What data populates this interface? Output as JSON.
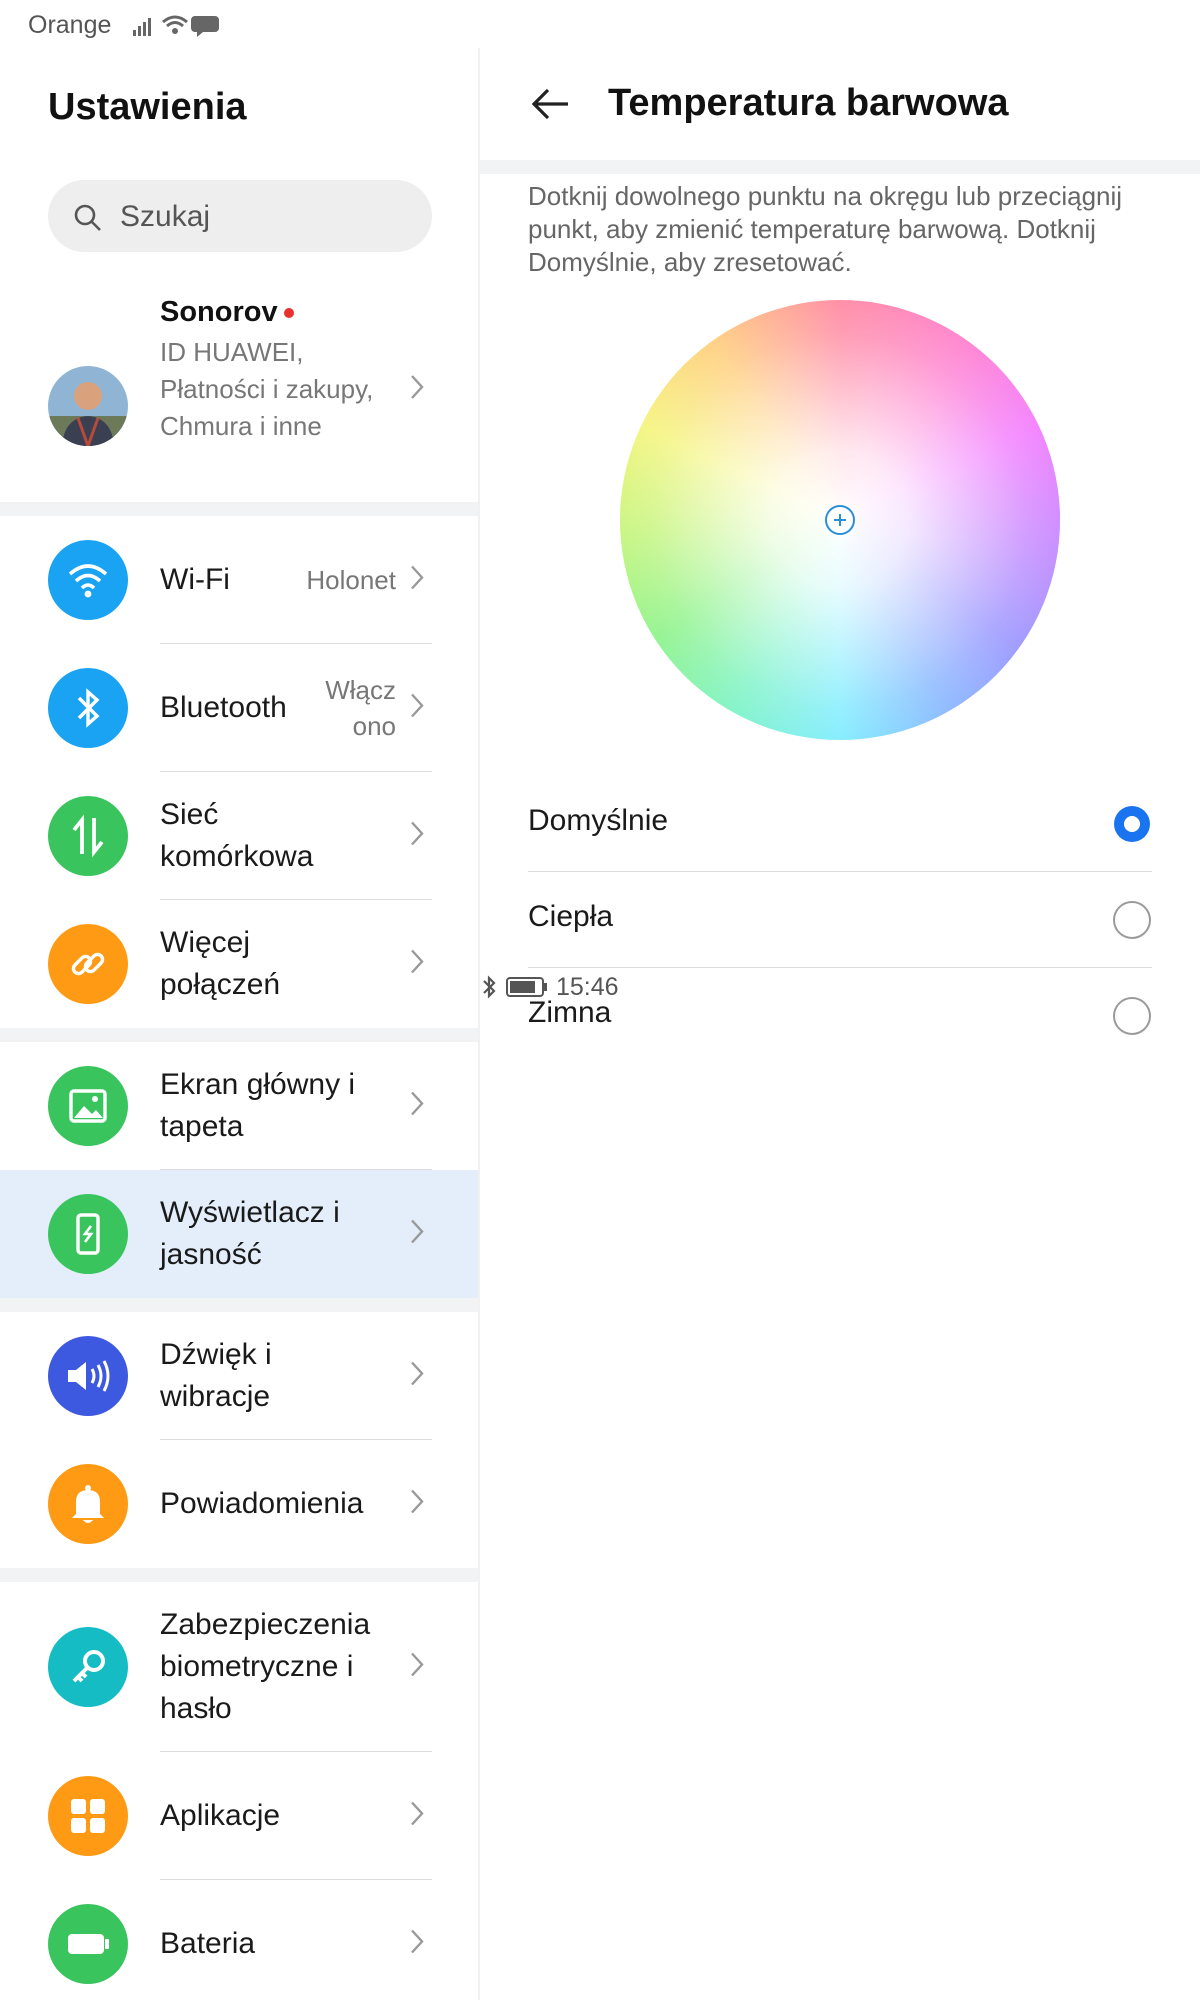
{
  "status_bar": {
    "carrier": "Orange",
    "time": "15:46"
  },
  "settings": {
    "title": "Ustawienia",
    "search_placeholder": "Szukaj",
    "profile": {
      "name": "Sonorov",
      "subtitle": "ID HUAWEI, Płatności i zakupy, Chmura i inne"
    },
    "items": [
      {
        "label": "Wi-Fi",
        "value": "Holonet",
        "icon": "wifi-icon",
        "color": "#1aa3f2"
      },
      {
        "label": "Bluetooth",
        "value": "Włącz ono",
        "icon": "bluetooth-icon",
        "color": "#1aa3f2"
      },
      {
        "label": "Sieć komórkowa",
        "value": "",
        "icon": "mobile-data-icon",
        "color": "#3ac45e"
      },
      {
        "label": "Więcej połączeń",
        "value": "",
        "icon": "link-icon",
        "color": "#ff9a14"
      },
      {
        "label": "Ekran główny i tapeta",
        "value": "",
        "icon": "image-icon",
        "color": "#3ac45e"
      },
      {
        "label": "Wyświetlacz i jasność",
        "value": "",
        "icon": "display-icon",
        "color": "#3ac45e"
      },
      {
        "label": "Dźwięk i wibracje",
        "value": "",
        "icon": "speaker-icon",
        "color": "#3d59e0"
      },
      {
        "label": "Powiadomienia",
        "value": "",
        "icon": "bell-icon",
        "color": "#ff9a14"
      },
      {
        "label": "Zabezpieczenia biometryczne i hasło",
        "value": "",
        "icon": "key-icon",
        "color": "#16bcc4"
      },
      {
        "label": "Aplikacje",
        "value": "",
        "icon": "apps-icon",
        "color": "#ff9a14"
      },
      {
        "label": "Bateria",
        "value": "",
        "icon": "battery-icon",
        "color": "#3ac45e"
      }
    ]
  },
  "color_temp": {
    "title": "Temperatura barwowa",
    "description": "Dotknij dowolnego punktu na okręgu lub przeciągnij punkt, aby zmienić temperaturę barwową. Dotknij Domyślnie, aby zresetować.",
    "options": [
      {
        "label": "Domyślnie",
        "selected": true
      },
      {
        "label": "Ciepła",
        "selected": false
      },
      {
        "label": "Zimna",
        "selected": false
      }
    ],
    "accent": "#1a74f0"
  }
}
